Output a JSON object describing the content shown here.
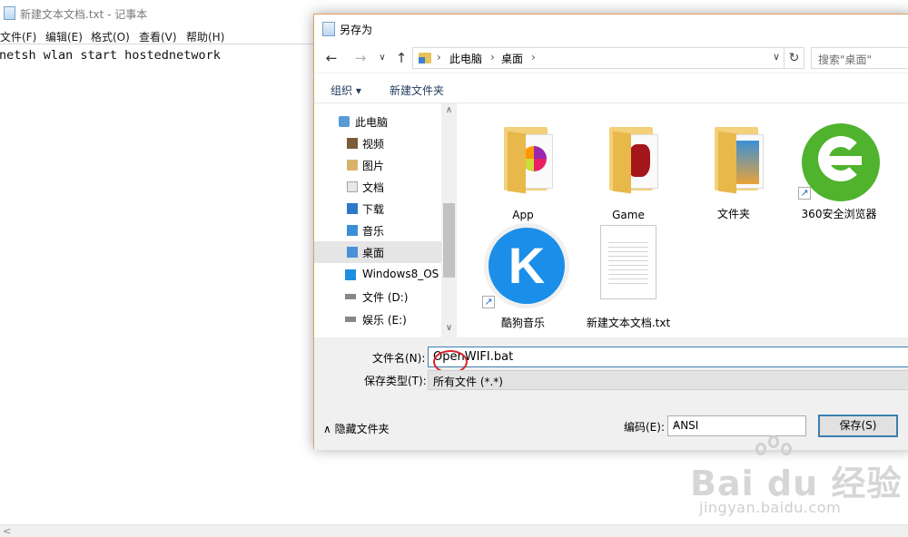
{
  "notepad": {
    "title": "新建文本文档.txt - 记事本",
    "menu": [
      "文件(F)",
      "编辑(E)",
      "格式(O)",
      "查看(V)",
      "帮助(H)"
    ],
    "content": "netsh wlan start hostednetwork"
  },
  "dialog": {
    "title": "另存为",
    "breadcrumb": [
      "此电脑",
      "桌面"
    ],
    "search_placeholder": "搜索\"桌面\"",
    "toolbar": {
      "organize": "组织 ▾",
      "new_folder": "新建文件夹"
    },
    "nav_items": [
      {
        "label": "此电脑",
        "icon": "computer-icon"
      },
      {
        "label": "视频",
        "icon": "video-folder-icon"
      },
      {
        "label": "图片",
        "icon": "pictures-folder-icon"
      },
      {
        "label": "文档",
        "icon": "documents-folder-icon"
      },
      {
        "label": "下载",
        "icon": "downloads-folder-icon"
      },
      {
        "label": "音乐",
        "icon": "music-folder-icon"
      },
      {
        "label": "桌面",
        "icon": "desktop-folder-icon",
        "selected": true
      },
      {
        "label": "Windows8_OS",
        "icon": "windows-drive-icon"
      },
      {
        "label": "文件 (D:)",
        "icon": "drive-icon"
      },
      {
        "label": "娱乐 (E:)",
        "icon": "drive-icon"
      }
    ],
    "files": [
      {
        "label": "App",
        "type": "folder"
      },
      {
        "label": "Game",
        "type": "folder"
      },
      {
        "label": "文件夹",
        "type": "folder"
      },
      {
        "label": "360安全浏览器",
        "type": "shortcut"
      },
      {
        "label": "酷狗音乐",
        "type": "shortcut"
      },
      {
        "label": "新建文本文档.txt",
        "type": "text-file"
      }
    ],
    "filename_label": "文件名(N):",
    "filename_value": "OpenWIFI.bat",
    "filetype_label": "保存类型(T):",
    "filetype_value": "所有文件  (*.*)",
    "hide_folders": "隐藏文件夹",
    "encoding_label": "编码(E):",
    "encoding_value": "ANSI",
    "save_button": "保存(S)"
  },
  "watermark": {
    "brand": "Bai du 经验",
    "url": "jingyan.baidu.com"
  },
  "colors": {
    "accent": "#3c7fb1",
    "highlight_circle": "#d9252a",
    "dialog_border": "#e5a15e"
  }
}
